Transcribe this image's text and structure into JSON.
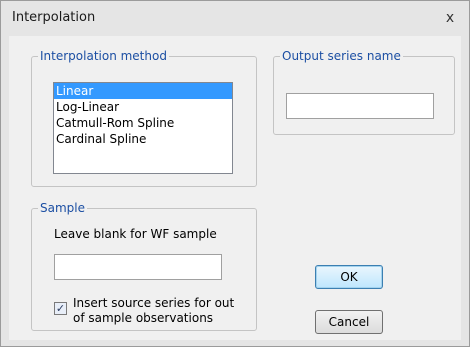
{
  "window": {
    "title": "Interpolation",
    "close_glyph": "x"
  },
  "method": {
    "legend": "Interpolation method",
    "items": [
      "Linear",
      "Log-Linear",
      "Catmull-Rom Spline",
      "Cardinal Spline"
    ],
    "selected": "Linear"
  },
  "output": {
    "legend": "Output series name",
    "value": ""
  },
  "sample": {
    "legend": "Sample",
    "hint": "Leave blank for WF sample",
    "value": "",
    "checkbox_checked": true,
    "checkbox_label": "Insert source series for out of sample observations"
  },
  "buttons": {
    "ok": "OK",
    "cancel": "Cancel"
  },
  "colors": {
    "legend_text": "#1c4fa3",
    "selection": "#3399ff",
    "ok_border": "#3c7fb1"
  }
}
